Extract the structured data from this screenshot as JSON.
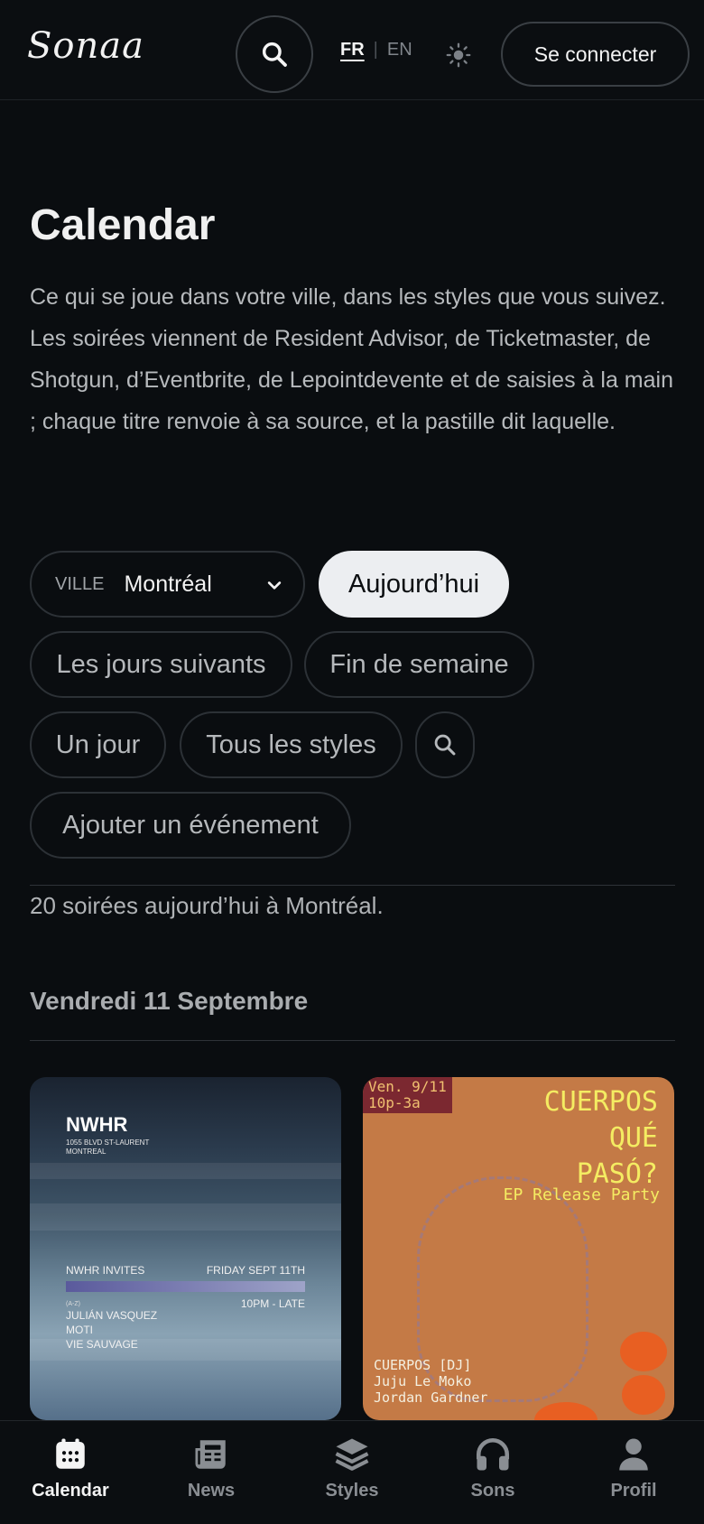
{
  "header": {
    "logo_text": "Sonaa",
    "lang_fr": "FR",
    "lang_sep": "|",
    "lang_en": "EN",
    "login_label": "Se connecter"
  },
  "main": {
    "title": "Calendar",
    "intro": "Ce qui se joue dans votre ville, dans les styles que vous suivez. Les soirées viennent de Resident Advisor, de Ticketmaster, de Shotgun, d’Eventbrite, de Lepointdevente et de saisies à la main ; chaque titre renvoie à sa source, et la pastille dit laquelle.",
    "city_label": "VILLE",
    "city_value": "Montréal",
    "chips": {
      "today": "Aujourd’hui",
      "next_days": "Les jours suivants",
      "weekend": "Fin de semaine",
      "one_day": "Un jour",
      "all_styles": "Tous les styles",
      "add_event": "Ajouter un événement"
    },
    "count_text": "20 soirées aujourd’hui à Montréal.",
    "day_heading": "Vendredi 11 Septembre"
  },
  "events": [
    {
      "venue": "NWHR",
      "address": "1055 BLVD ST-LAURENT MONTREAL",
      "invites": "NWHR INVITES",
      "date": "FRIDAY SEPT 11TH",
      "time": "10PM - LATE",
      "tag": "(A-Z)",
      "lineup": [
        "JULIÁN VASQUEZ",
        "MOTI",
        "VIE SAUVAGE"
      ]
    },
    {
      "tag_line1": "Ven. 9/11",
      "tag_line2": "10p-3a",
      "title_line1": "CUERPOS",
      "title_line2": "QUÉ",
      "title_line3": "PASÓ?",
      "subtitle": "EP Release Party",
      "lineup": [
        "CUERPOS [DJ]",
        "Juju Le Moko",
        "Jordan Gardner"
      ]
    }
  ],
  "bottom_nav": [
    {
      "label": "Calendar",
      "icon": "calendar-icon",
      "active": true
    },
    {
      "label": "News",
      "icon": "newspaper-icon",
      "active": false
    },
    {
      "label": "Styles",
      "icon": "layers-icon",
      "active": false
    },
    {
      "label": "Sons",
      "icon": "headphones-icon",
      "active": false
    },
    {
      "label": "Profil",
      "icon": "user-icon",
      "active": false
    }
  ],
  "colors": {
    "background": "#0a0d10",
    "active_chip": "#eceef1",
    "poster_yellow": "#f4ec62",
    "poster_orange": "#c47a46"
  }
}
